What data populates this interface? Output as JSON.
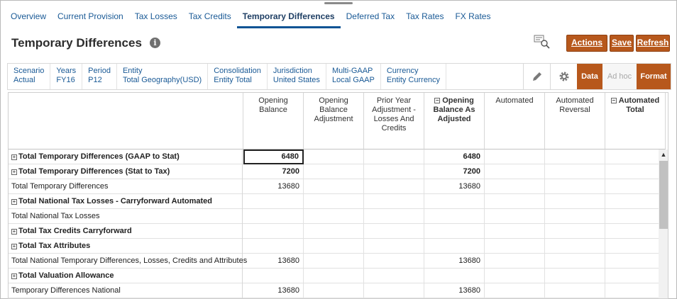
{
  "tabs": [
    {
      "label": "Overview"
    },
    {
      "label": "Current Provision"
    },
    {
      "label": "Tax Losses"
    },
    {
      "label": "Tax Credits"
    },
    {
      "label": "Temporary Differences",
      "active": true
    },
    {
      "label": "Deferred Tax"
    },
    {
      "label": "Tax Rates"
    },
    {
      "label": "FX Rates"
    }
  ],
  "header": {
    "title": "Temporary Differences",
    "info_glyph": "i",
    "actions_label": "Actions",
    "save_label": "Save",
    "refresh_label": "Refresh"
  },
  "pov": [
    {
      "name": "Scenario",
      "value": "Actual"
    },
    {
      "name": "Years",
      "value": "FY16"
    },
    {
      "name": "Period",
      "value": "P12"
    },
    {
      "name": "Entity",
      "value": "Total Geography(USD)"
    },
    {
      "name": "Consolidation",
      "value": "Entity Total"
    },
    {
      "name": "Jurisdiction",
      "value": "United States"
    },
    {
      "name": "Multi-GAAP",
      "value": "Local GAAP"
    },
    {
      "name": "Currency",
      "value": "Entity Currency"
    }
  ],
  "modes": {
    "data": "Data",
    "adhoc": "Ad hoc",
    "format": "Format"
  },
  "columns": [
    {
      "label": "Opening Balance",
      "bold": false,
      "collapsible": false
    },
    {
      "label": "Opening Balance Adjustment",
      "bold": false,
      "collapsible": false
    },
    {
      "label": "Prior Year Adjustment - Losses And Credits",
      "bold": false,
      "collapsible": false
    },
    {
      "label": "Opening Balance As Adjusted",
      "bold": true,
      "collapsible": true
    },
    {
      "label": "Automated",
      "bold": false,
      "collapsible": false
    },
    {
      "label": "Automated Reversal",
      "bold": false,
      "collapsible": false
    },
    {
      "label": "Automated Total",
      "bold": true,
      "collapsible": true
    }
  ],
  "rows": [
    {
      "label": "Total Temporary Differences (GAAP to Stat)",
      "expandable": true,
      "bold": true,
      "values": [
        "6480",
        "",
        "",
        "6480",
        "",
        "",
        ""
      ],
      "selected_col": 0
    },
    {
      "label": "Total Temporary Differences (Stat to Tax)",
      "expandable": true,
      "bold": true,
      "values": [
        "7200",
        "",
        "",
        "7200",
        "",
        "",
        ""
      ]
    },
    {
      "label": "Total Temporary Differences",
      "expandable": false,
      "bold": false,
      "values": [
        "13680",
        "",
        "",
        "13680",
        "",
        "",
        ""
      ]
    },
    {
      "label": "Total National Tax Losses - Carryforward Automated",
      "expandable": true,
      "bold": true,
      "values": [
        "",
        "",
        "",
        "",
        "",
        "",
        ""
      ]
    },
    {
      "label": "Total National Tax Losses",
      "expandable": false,
      "bold": false,
      "values": [
        "",
        "",
        "",
        "",
        "",
        "",
        ""
      ]
    },
    {
      "label": "Total Tax Credits Carryforward",
      "expandable": true,
      "bold": true,
      "values": [
        "",
        "",
        "",
        "",
        "",
        "",
        ""
      ]
    },
    {
      "label": "Total Tax Attributes",
      "expandable": true,
      "bold": true,
      "values": [
        "",
        "",
        "",
        "",
        "",
        "",
        ""
      ]
    },
    {
      "label": "Total National Temporary Differences, Losses, Credits and Attributes",
      "expandable": false,
      "bold": false,
      "values": [
        "13680",
        "",
        "",
        "13680",
        "",
        "",
        ""
      ]
    },
    {
      "label": "Total Valuation Allowance",
      "expandable": true,
      "bold": true,
      "values": [
        "",
        "",
        "",
        "",
        "",
        "",
        ""
      ]
    },
    {
      "label": "Temporary Differences National",
      "expandable": false,
      "bold": false,
      "values": [
        "13680",
        "",
        "",
        "13680",
        "",
        "",
        ""
      ]
    }
  ],
  "colors": {
    "accent": "#b7581c",
    "link": "#1a5a96",
    "tab_underline": "#0b5394"
  }
}
